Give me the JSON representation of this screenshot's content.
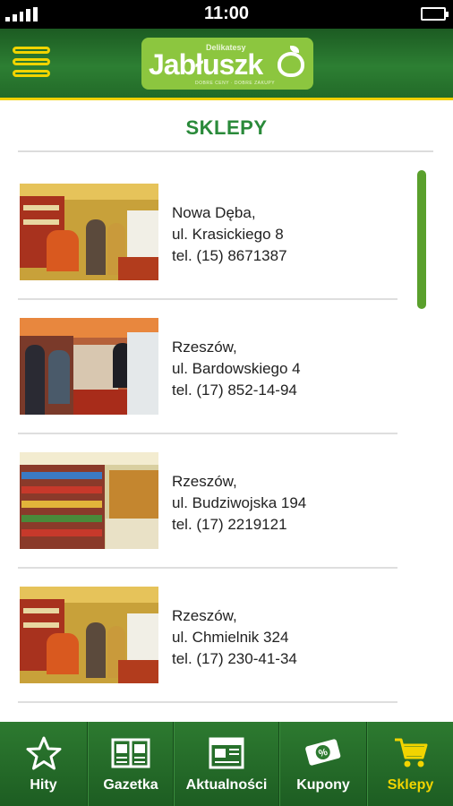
{
  "status_bar": {
    "time": "11:00"
  },
  "header": {
    "logo": {
      "small_text": "Delikatesy",
      "brand": "Jabłuszk",
      "tagline": "DOBRE CENY · DOBRE ZAKUPY"
    }
  },
  "page": {
    "title": "SKLEPY"
  },
  "stores": [
    {
      "city": "Nowa Dęba,",
      "street": "ul. Krasickiego 8",
      "phone": "tel. (15) 8671387"
    },
    {
      "city": "Rzeszów,",
      "street": "ul. Bardowskiego 4",
      "phone": "tel. (17) 852-14-94"
    },
    {
      "city": "Rzeszów,",
      "street": "ul. Budziwojska 194",
      "phone": "tel. (17) 2219121"
    },
    {
      "city": "Rzeszów,",
      "street": "ul. Chmielnik 324",
      "phone": "tel. (17) 230-41-34"
    }
  ],
  "bottom_nav": [
    {
      "label": "Hity",
      "icon": "star-icon"
    },
    {
      "label": "Gazetka",
      "icon": "newspaper-icon"
    },
    {
      "label": "Aktualności",
      "icon": "news-icon"
    },
    {
      "label": "Kupony",
      "icon": "coupon-icon"
    },
    {
      "label": "Sklepy",
      "icon": "cart-icon",
      "active": true
    }
  ],
  "colors": {
    "header_green": "#2d7f33",
    "accent_yellow": "#f1d400",
    "title_green": "#2a8a3a",
    "logo_green": "#8cc63f"
  }
}
